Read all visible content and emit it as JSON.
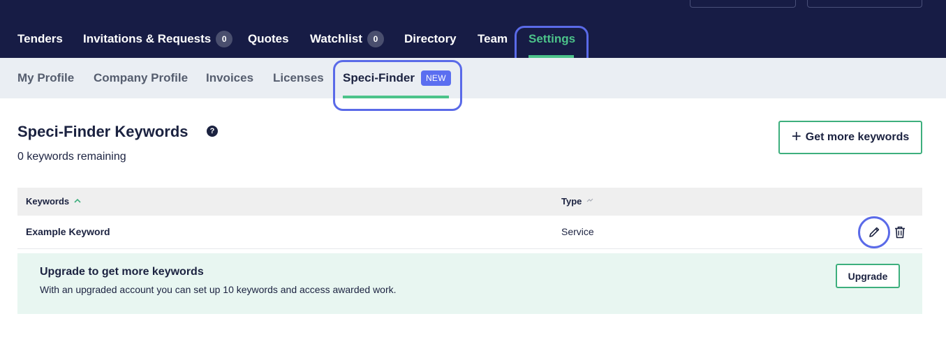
{
  "nav": {
    "items": [
      {
        "label": "Tenders"
      },
      {
        "label": "Invitations & Requests",
        "count": "0"
      },
      {
        "label": "Quotes"
      },
      {
        "label": "Watchlist",
        "count": "0"
      },
      {
        "label": "Directory"
      },
      {
        "label": "Team"
      },
      {
        "label": "Settings",
        "active": true
      }
    ]
  },
  "subnav": {
    "items": [
      {
        "label": "My Profile"
      },
      {
        "label": "Company Profile"
      },
      {
        "label": "Invoices"
      },
      {
        "label": "Licenses"
      },
      {
        "label": "Speci-Finder",
        "badge": "NEW",
        "active": true
      }
    ]
  },
  "page": {
    "title": "Speci-Finder Keywords",
    "help_icon_glyph": "?",
    "remaining": "0 keywords remaining",
    "get_more_label": "Get more keywords",
    "get_more_icon": "plus-icon"
  },
  "table": {
    "columns": [
      {
        "label": "Keywords",
        "sort": "ascending"
      },
      {
        "label": "Type",
        "sort": "none"
      }
    ],
    "rows": [
      {
        "keyword": "Example Keyword",
        "type": "Service",
        "actions": [
          "pencil-icon",
          "trash-icon"
        ]
      }
    ]
  },
  "upgrade": {
    "title": "Upgrade to get more keywords",
    "text": "With an upgraded account you can set up 10 keywords and access awarded work.",
    "button_label": "Upgrade"
  },
  "colors": {
    "nav_bg": "#171c45",
    "accent_green": "#4cc38a",
    "badge_blue": "#5b6ef0",
    "highlight_ring": "#5a6ae8",
    "upgrade_bg": "#e8f6f1"
  }
}
